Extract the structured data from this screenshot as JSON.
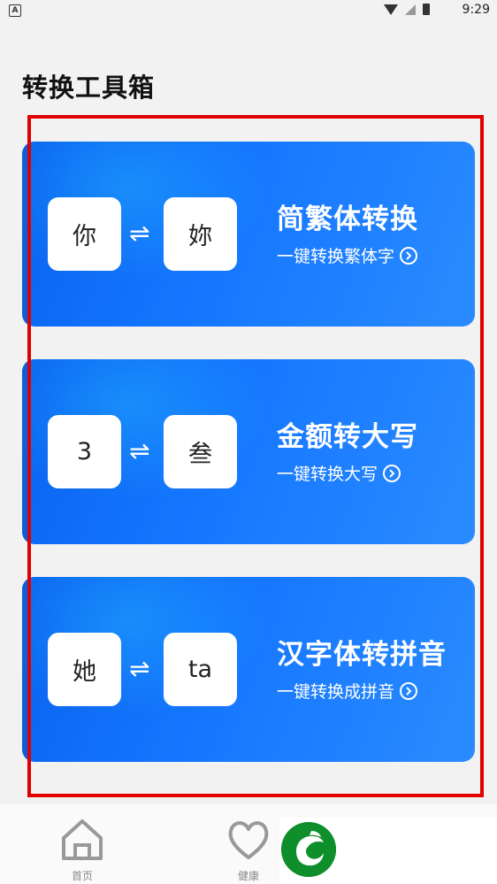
{
  "status_bar": {
    "time": "9:29",
    "left_icon": "A"
  },
  "page": {
    "title": "转换工具箱"
  },
  "cards": [
    {
      "title": "简繁体转换",
      "subtitle": "一键转换繁体字",
      "from": "你",
      "to": "妳",
      "swap": "⇌"
    },
    {
      "title": "金额转大写",
      "subtitle": "一键转换大写",
      "from": "3",
      "to": "叁",
      "swap": "⇌"
    },
    {
      "title": "汉字体转拼音",
      "subtitle": "一键转换成拼音",
      "from": "她",
      "to": "ta",
      "swap": "⇌"
    }
  ],
  "nav": {
    "home": "首页",
    "health": "健康"
  },
  "colors": {
    "accent": "#1577ff",
    "highlight": "#e00000",
    "logo": "#0e8f2b"
  }
}
